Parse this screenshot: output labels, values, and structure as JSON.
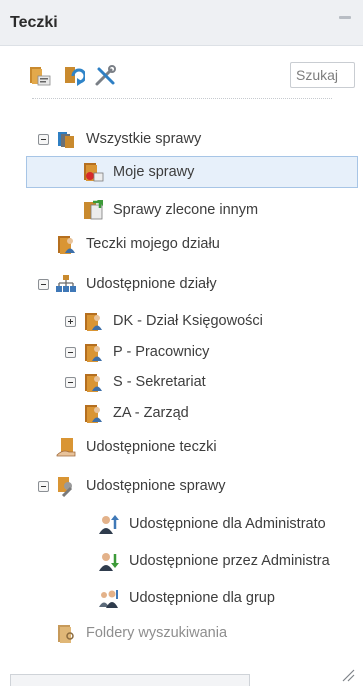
{
  "header": {
    "title": "Teczki"
  },
  "toolbar": {
    "search_placeholder": "Szukaj"
  },
  "tree": {
    "wszystkie_sprawy": "Wszystkie sprawy",
    "moje_sprawy": "Moje sprawy",
    "sprawy_zlecone": "Sprawy zlecone innym",
    "teczki_dzialu": "Teczki mojego działu",
    "udostepnione_dzialy": "Udostępnione działy",
    "dk": "DK - Dział Księgowości",
    "p": "P - Pracownicy",
    "s": "S - Sekretariat",
    "za": "ZA - Zarząd",
    "udostepnione_teczki": "Udostępnione teczki",
    "udostepnione_sprawy": "Udostępnione sprawy",
    "dla_admin": "Udostępnione dla Administrato",
    "przez_admin": "Udostępnione przez Administra",
    "dla_grup": "Udostępnione dla grup",
    "foldery": "Foldery wyszukiwania"
  },
  "colors": {
    "selection_bg": "#e7f0fa",
    "selection_border": "#a7c5e6",
    "folder": "#c98a2e",
    "accent_blue": "#3f78b7",
    "accent_green": "#3c9a39"
  },
  "icons": {
    "toolbar": [
      "new-folder-icon",
      "refresh-icon",
      "tools-icon"
    ],
    "tree": [
      "folder-icon",
      "user-icon",
      "group-icon",
      "hierarchy-icon"
    ]
  }
}
